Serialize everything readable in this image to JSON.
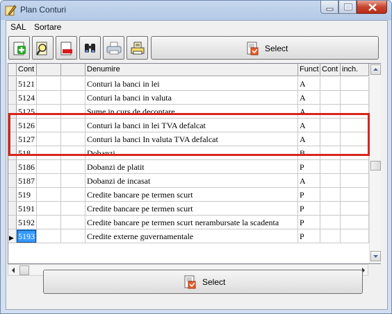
{
  "window": {
    "title": "Plan Conturi"
  },
  "menu": {
    "items": [
      "SAL",
      "Sortare"
    ]
  },
  "toolbar": {
    "select_label": "Select"
  },
  "grid": {
    "columns": [
      "Cont",
      "",
      "",
      "Denumire",
      "Funct",
      "Cont",
      "inch."
    ],
    "rows": [
      {
        "code": "5121",
        "name": "Conturi la banci in lei",
        "funct": "A"
      },
      {
        "code": "5124",
        "name": "Conturi la banci in valuta",
        "funct": "A"
      },
      {
        "code": "5125",
        "name": "Sume in curs de decontare",
        "funct": "A"
      },
      {
        "code": "5126",
        "name": "Conturi la banci in lei TVA defalcat",
        "funct": "A"
      },
      {
        "code": "5127",
        "name": "Conturi la banci In valuta TVA defalcat",
        "funct": "A"
      },
      {
        "code": "518",
        "name": "Dobanzi",
        "funct": "B"
      },
      {
        "code": "5186",
        "name": "Dobanzi de platit",
        "funct": "P"
      },
      {
        "code": "5187",
        "name": "Dobanzi de incasat",
        "funct": "A"
      },
      {
        "code": "519",
        "name": "Credite bancare pe termen scurt",
        "funct": "P"
      },
      {
        "code": "5191",
        "name": "Credite bancare pe termen scurt",
        "funct": "P"
      },
      {
        "code": "5192",
        "name": "Credite bancare pe termen scurt nerambursate la scadenta",
        "funct": "P"
      },
      {
        "code": "5193",
        "name": "Credite externe guvernamentale",
        "funct": "P"
      }
    ],
    "current_row_marker": "▶"
  },
  "footer": {
    "select_label": "Select"
  },
  "colors": {
    "highlight": "#d9241c",
    "selection": "#3399ff"
  }
}
